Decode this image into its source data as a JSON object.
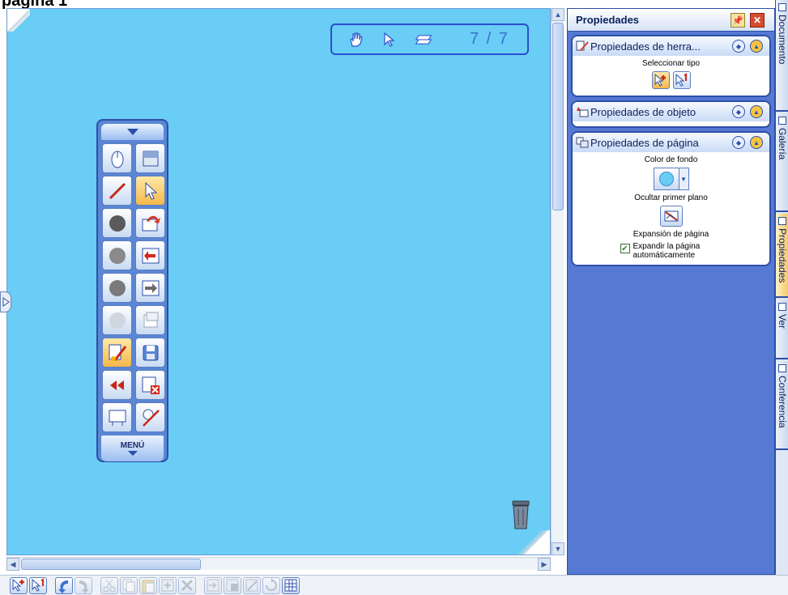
{
  "doc_title": "página 1",
  "page_nav": {
    "counter": "7 / 7",
    "icons": [
      "hand-icon",
      "pointer-icon",
      "page-stack-icon"
    ]
  },
  "floating_toolbar": {
    "buttons": [
      "mouse-icon",
      "screen-shade-icon",
      "pen-icon",
      "select-arrow-icon",
      "dark-circle-icon",
      "import-icon",
      "gray-circle-icon",
      "previous-page-icon",
      "gray-circle-2-icon",
      "next-page-icon",
      "light-circle-icon",
      "blank-page-icon",
      "properties-icon",
      "save-icon",
      "rewind-icon",
      "delete-page-icon",
      "whiteboard-icon",
      "line-tool-icon"
    ],
    "active": [
      3,
      12
    ],
    "menu_label": "MENÚ"
  },
  "props_panel": {
    "title": "Propiedades",
    "sections": {
      "tool": {
        "header": "Propiedades de herra...",
        "select_type_label": "Seleccionar tipo"
      },
      "object": {
        "header": "Propiedades de objeto"
      },
      "page": {
        "header": "Propiedades de página",
        "bg_color_label": "Color de fondo",
        "hide_foreground_label": "Ocultar primer plano",
        "page_expansion_label": "Expansión de página",
        "auto_expand_label": "Expandir la página automáticamente",
        "auto_expand_checked": true,
        "bg_color": "#69cdf5"
      }
    }
  },
  "tabs": [
    {
      "label": "Documento",
      "active": false
    },
    {
      "label": "Galería",
      "active": false
    },
    {
      "label": "Propiedades",
      "active": true
    },
    {
      "label": "Ver",
      "active": false
    },
    {
      "label": "Conferencia",
      "active": false
    }
  ],
  "bottom_toolbar": {
    "buttons": [
      "add-select-icon",
      "number-select-icon",
      "undo-icon",
      "redo-icon",
      "cut-icon",
      "copy-icon",
      "paste-icon",
      "clone-icon",
      "delete-icon",
      "send-back-icon",
      "bring-front-icon",
      "edit-icon",
      "rotate-icon",
      "grid-icon"
    ]
  },
  "colors": {
    "canvas": "#69cdf5",
    "panel": "#5679d4",
    "accent": "#2c4fa8"
  }
}
